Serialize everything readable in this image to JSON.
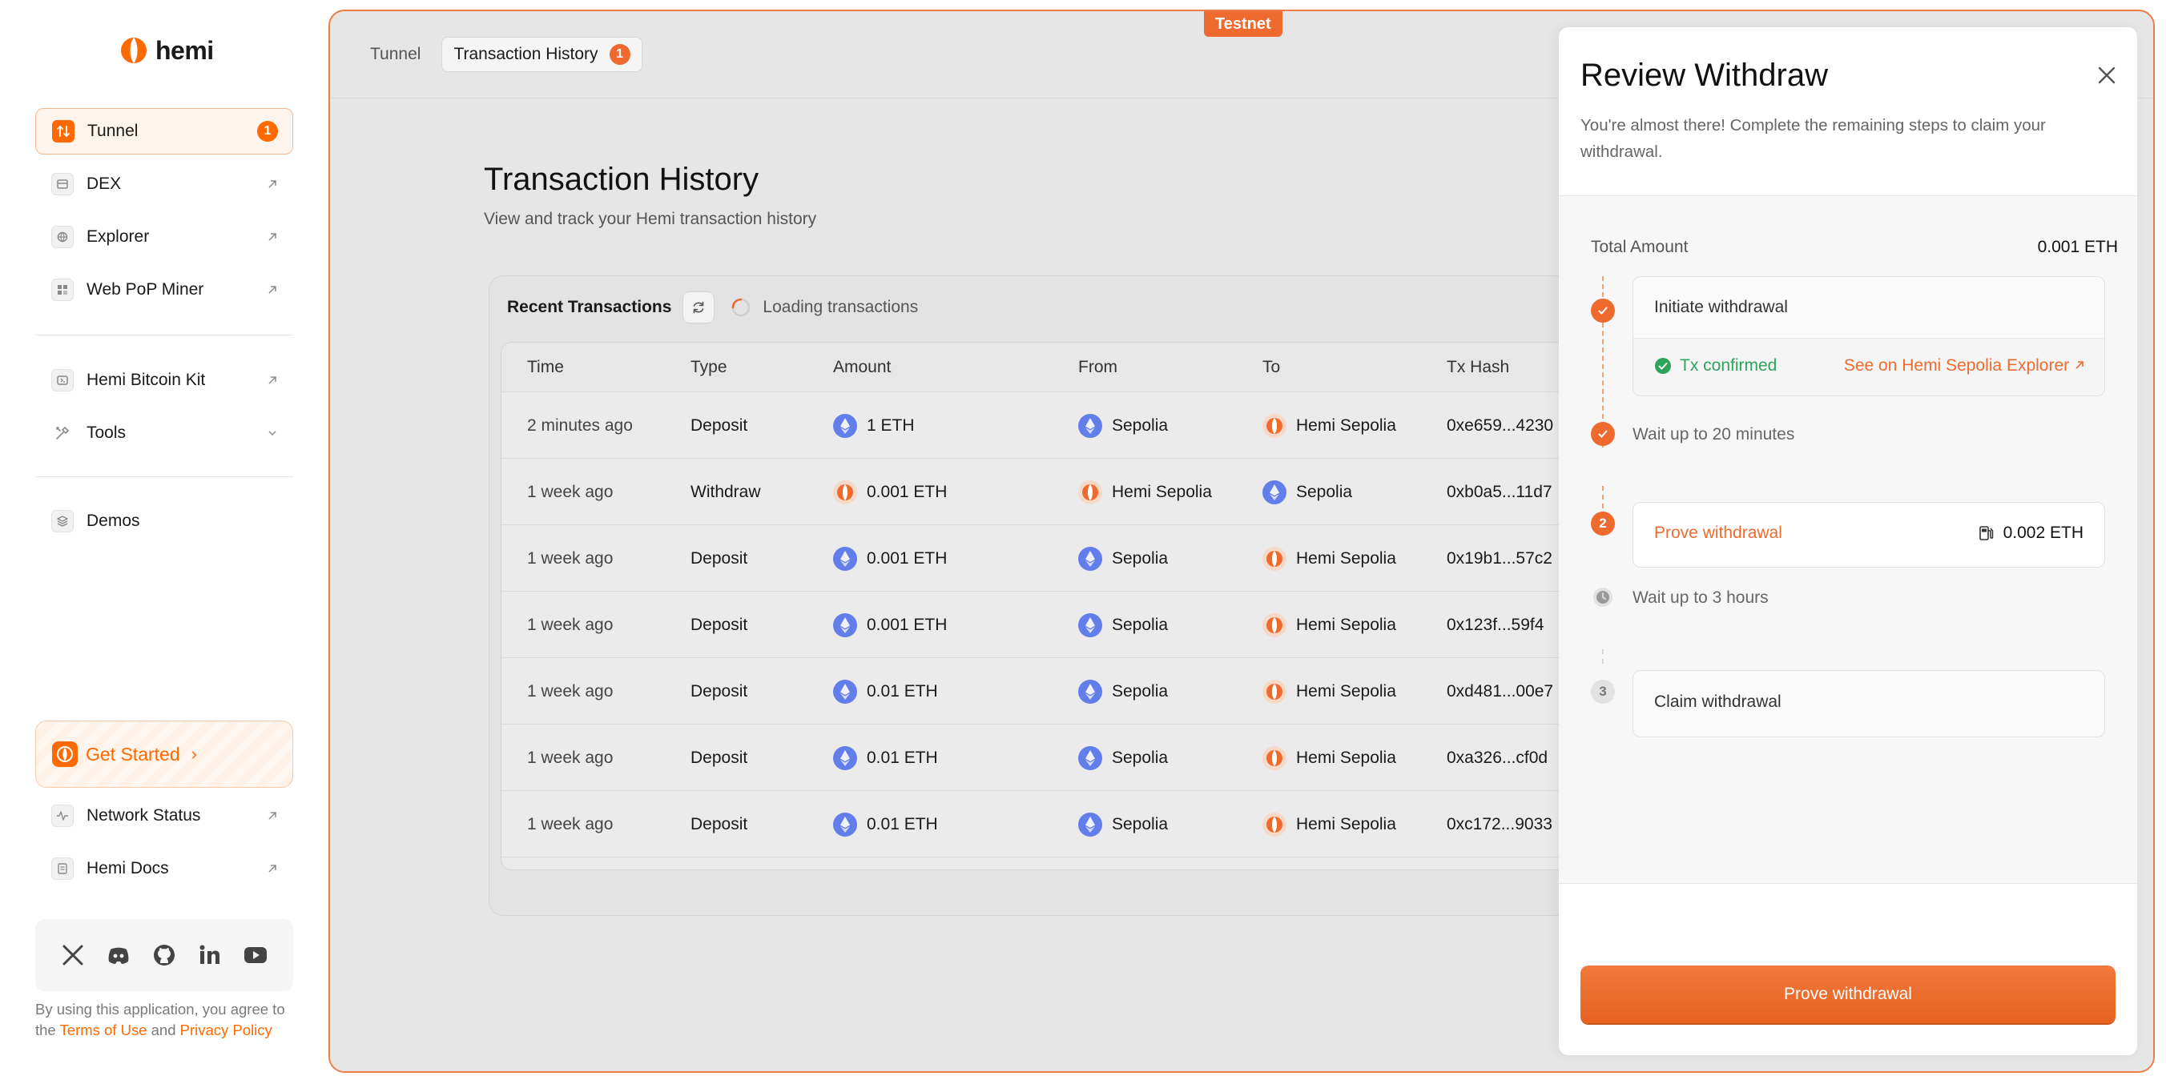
{
  "app": {
    "name": "hemi"
  },
  "sidebar": {
    "primary": [
      {
        "label": "Tunnel",
        "badge": "1"
      },
      {
        "label": "DEX"
      },
      {
        "label": "Explorer"
      },
      {
        "label": "Web PoP Miner"
      }
    ],
    "secondary": [
      {
        "label": "Hemi Bitcoin Kit"
      },
      {
        "label": "Tools"
      }
    ],
    "tertiary": [
      {
        "label": "Demos"
      }
    ],
    "get_started": "Get Started",
    "footer_links": [
      {
        "label": "Network Status"
      },
      {
        "label": "Hemi Docs"
      }
    ],
    "legal": {
      "prefix": "By using this application, you agree to the ",
      "terms": "Terms of Use",
      "and": " and ",
      "privacy": "Privacy Policy"
    }
  },
  "header": {
    "environment_badge": "Testnet",
    "tabs": [
      {
        "label": "Tunnel"
      },
      {
        "label": "Transaction History",
        "badge": "1"
      }
    ]
  },
  "page": {
    "title": "Transaction History",
    "subtitle": "View and track your Hemi transaction history"
  },
  "transactions": {
    "card_title": "Recent Transactions",
    "loading_label": "Loading transactions",
    "columns": [
      "Time",
      "Type",
      "Amount",
      "From",
      "To",
      "Tx Hash"
    ],
    "rows": [
      {
        "time": "2 minutes ago",
        "type": "Deposit",
        "amount": "1 ETH",
        "amount_token": "eth",
        "from": "Sepolia",
        "from_icon": "eth",
        "to": "Hemi Sepolia",
        "to_icon": "hemi",
        "hash": "0xe659...4230"
      },
      {
        "time": "1 week ago",
        "type": "Withdraw",
        "amount": "0.001 ETH",
        "amount_token": "hemi",
        "from": "Hemi Sepolia",
        "from_icon": "hemi",
        "to": "Sepolia",
        "to_icon": "eth",
        "hash": "0xb0a5...11d7"
      },
      {
        "time": "1 week ago",
        "type": "Deposit",
        "amount": "0.001 ETH",
        "amount_token": "eth",
        "from": "Sepolia",
        "from_icon": "eth",
        "to": "Hemi Sepolia",
        "to_icon": "hemi",
        "hash": "0x19b1...57c2"
      },
      {
        "time": "1 week ago",
        "type": "Deposit",
        "amount": "0.001 ETH",
        "amount_token": "eth",
        "from": "Sepolia",
        "from_icon": "eth",
        "to": "Hemi Sepolia",
        "to_icon": "hemi",
        "hash": "0x123f...59f4"
      },
      {
        "time": "1 week ago",
        "type": "Deposit",
        "amount": "0.01 ETH",
        "amount_token": "eth",
        "from": "Sepolia",
        "from_icon": "eth",
        "to": "Hemi Sepolia",
        "to_icon": "hemi",
        "hash": "0xd481...00e7"
      },
      {
        "time": "1 week ago",
        "type": "Deposit",
        "amount": "0.01 ETH",
        "amount_token": "eth",
        "from": "Sepolia",
        "from_icon": "eth",
        "to": "Hemi Sepolia",
        "to_icon": "hemi",
        "hash": "0xa326...cf0d"
      },
      {
        "time": "1 week ago",
        "type": "Deposit",
        "amount": "0.01 ETH",
        "amount_token": "eth",
        "from": "Sepolia",
        "from_icon": "eth",
        "to": "Hemi Sepolia",
        "to_icon": "hemi",
        "hash": "0xc172...9033"
      }
    ]
  },
  "drawer": {
    "title": "Review Withdraw",
    "subtitle": "You're almost there! Complete the remaining steps to claim your withdrawal.",
    "total_label": "Total Amount",
    "total_value": "0.001 ETH",
    "steps": {
      "initiate": {
        "title": "Initiate withdrawal",
        "status": "Tx confirmed",
        "link": "See on Hemi Sepolia Explorer"
      },
      "wait1": "Wait up to 20 minutes",
      "prove": {
        "number": "2",
        "title": "Prove withdrawal",
        "fee": "0.002 ETH"
      },
      "wait2": "Wait up to 3 hours",
      "claim": {
        "number": "3",
        "title": "Claim withdrawal"
      }
    },
    "button": "Prove withdrawal"
  },
  "colors": {
    "accent": "#ef6a2f",
    "success": "#2ea35b",
    "eth": "#627eea"
  }
}
